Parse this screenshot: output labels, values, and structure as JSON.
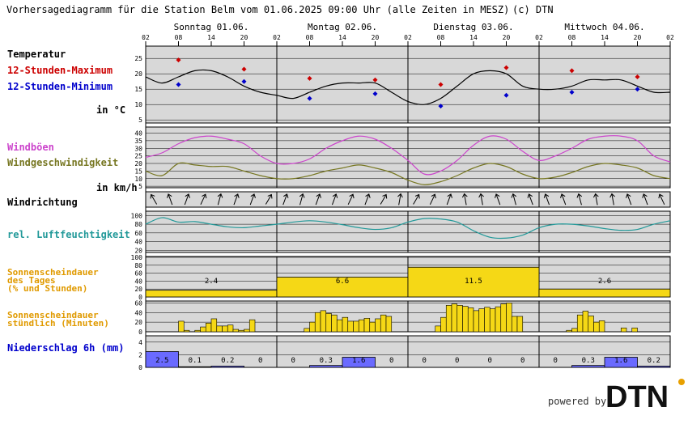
{
  "header": {
    "title": "Vorhersagediagramm für die Station Belm vom 01.06.2025 09:00 Uhr (alle Zeiten in MESZ)",
    "copyright": "(c) DTN"
  },
  "days": [
    "Sonntag 01.06.",
    "Montag 02.06.",
    "Dienstag 03.06.",
    "Mittwoch 04.06."
  ],
  "hour_labels": [
    "02",
    "08",
    "14",
    "20",
    "02",
    "08",
    "14",
    "20",
    "02",
    "08",
    "14",
    "20",
    "02",
    "08",
    "14",
    "20",
    "02"
  ],
  "panels": {
    "temperature": {
      "title": "Temperatur",
      "max_label": "12-Stunden-Maximum",
      "min_label": "12-Stunden-Minimum",
      "unit": "in °C",
      "ticks": [
        "25",
        "20",
        "15",
        "10",
        "5"
      ]
    },
    "wind": {
      "gust_label": "Windböen",
      "speed_label": "Windgeschwindigkeit",
      "unit": "in km/h",
      "ticks": [
        "40",
        "35",
        "30",
        "25",
        "20",
        "15",
        "10",
        "5"
      ]
    },
    "wind_direction": {
      "title": "Windrichtung"
    },
    "humidity": {
      "title": "rel. Luftfeuchtigkeit",
      "ticks": [
        "100",
        "80",
        "60",
        "40",
        "20"
      ]
    },
    "sun_daily": {
      "title_line1": "Sonnenscheindauer",
      "title_line2": "des Tages",
      "title_line3": "(% und Stunden)",
      "ticks": [
        "100",
        "80",
        "60",
        "40",
        "20",
        "0"
      ]
    },
    "sun_hourly": {
      "title_line1": "Sonnenscheindauer",
      "title_line2": "stündlich (Minuten)",
      "ticks": [
        "60",
        "40",
        "20",
        "0"
      ]
    },
    "precip": {
      "title": "Niederschlag 6h (mm)",
      "ticks": [
        "4",
        "2",
        "0"
      ]
    }
  },
  "branding": {
    "powered_by": "powered by",
    "logo_text": "DTN"
  },
  "colors": {
    "panel_bg": "#d8d8d8",
    "max": "#cc0000",
    "min": "#0000cc",
    "gust": "#cc44cc",
    "speed": "#777722",
    "humidity": "#229999",
    "sun_label": "#e09a00",
    "sun_fill": "#f5d816",
    "precip_label": "#0000cc",
    "precip_fill": "#6a6aff"
  },
  "chart_data": [
    {
      "type": "line",
      "name": "temperature",
      "x_hours": [
        0,
        3,
        6,
        9,
        12,
        15,
        18,
        21,
        24,
        27,
        30,
        33,
        36,
        39,
        42,
        45,
        48,
        51,
        54,
        57,
        60,
        63,
        66,
        69,
        72,
        75,
        78,
        81,
        84,
        87,
        90,
        93,
        96
      ],
      "y": [
        19,
        17,
        19,
        21,
        21,
        19,
        16,
        14,
        13,
        12,
        14,
        16,
        17,
        17,
        17,
        14,
        11,
        10,
        12,
        16,
        20,
        21,
        20,
        16,
        15,
        15,
        16,
        18,
        18,
        18,
        16,
        14,
        14
      ],
      "max_points": [
        {
          "h": 6,
          "v": 24.5
        },
        {
          "h": 18,
          "v": 21.5
        },
        {
          "h": 30,
          "v": 18.5
        },
        {
          "h": 42,
          "v": 18
        },
        {
          "h": 54,
          "v": 16.5
        },
        {
          "h": 66,
          "v": 22
        },
        {
          "h": 78,
          "v": 21
        },
        {
          "h": 90,
          "v": 19
        }
      ],
      "min_points": [
        {
          "h": 6,
          "v": 16.5
        },
        {
          "h": 18,
          "v": 17.5
        },
        {
          "h": 30,
          "v": 12
        },
        {
          "h": 42,
          "v": 13.5
        },
        {
          "h": 54,
          "v": 9.5
        },
        {
          "h": 66,
          "v": 13
        },
        {
          "h": 78,
          "v": 14
        },
        {
          "h": 90,
          "v": 15
        }
      ],
      "ylim": [
        4,
        29
      ]
    },
    {
      "type": "line",
      "name": "wind",
      "x_hours": [
        0,
        3,
        6,
        9,
        12,
        15,
        18,
        21,
        24,
        27,
        30,
        33,
        36,
        39,
        42,
        45,
        48,
        51,
        54,
        57,
        60,
        63,
        66,
        69,
        72,
        75,
        78,
        81,
        84,
        87,
        90,
        93,
        96
      ],
      "gusts": [
        24,
        27,
        33,
        37,
        38,
        36,
        33,
        25,
        20,
        20,
        23,
        30,
        35,
        38,
        36,
        30,
        22,
        13,
        15,
        22,
        32,
        38,
        36,
        28,
        22,
        25,
        30,
        36,
        38,
        38,
        35,
        25,
        21
      ],
      "speed": [
        15,
        12,
        20,
        19,
        18,
        18,
        15,
        12,
        10,
        10,
        12,
        15,
        17,
        19,
        17,
        14,
        9,
        6,
        8,
        12,
        17,
        20,
        18,
        13,
        10,
        11,
        14,
        18,
        20,
        19,
        17,
        12,
        10
      ],
      "ylim": [
        4,
        44
      ]
    },
    {
      "type": "line",
      "name": "humidity",
      "x_hours": [
        0,
        3,
        6,
        9,
        12,
        15,
        18,
        21,
        24,
        27,
        30,
        33,
        36,
        39,
        42,
        45,
        48,
        51,
        54,
        57,
        60,
        63,
        66,
        69,
        72,
        75,
        78,
        81,
        84,
        87,
        90,
        93,
        96
      ],
      "y": [
        80,
        95,
        85,
        86,
        80,
        74,
        72,
        76,
        80,
        85,
        88,
        85,
        79,
        72,
        68,
        72,
        85,
        93,
        92,
        85,
        65,
        50,
        48,
        55,
        72,
        80,
        80,
        76,
        70,
        66,
        68,
        80,
        88
      ],
      "ylim": [
        15,
        110
      ]
    },
    {
      "type": "bar",
      "name": "sun_daily",
      "days": [
        {
          "pct": 17,
          "hours": "2.4"
        },
        {
          "pct": 50,
          "hours": "6.6"
        },
        {
          "pct": 75,
          "hours": "11.5"
        },
        {
          "pct": 20,
          "hours": "2.6"
        }
      ],
      "ylim": [
        0,
        100
      ]
    },
    {
      "type": "bar",
      "name": "sun_hourly",
      "minutes": [
        0,
        0,
        0,
        0,
        0,
        0,
        22,
        3,
        0,
        3,
        10,
        18,
        27,
        12,
        12,
        14,
        5,
        3,
        5,
        25,
        0,
        0,
        0,
        0,
        0,
        0,
        0,
        0,
        0,
        7,
        20,
        40,
        44,
        38,
        35,
        25,
        30,
        22,
        22,
        25,
        28,
        20,
        27,
        35,
        32,
        0,
        0,
        0,
        0,
        0,
        0,
        0,
        0,
        12,
        30,
        55,
        58,
        55,
        53,
        50,
        44,
        48,
        51,
        48,
        52,
        58,
        60,
        32,
        32,
        0,
        0,
        0,
        0,
        0,
        0,
        0,
        0,
        3,
        7,
        35,
        43,
        33,
        20,
        23,
        0,
        0,
        0,
        8,
        0,
        8,
        0,
        0,
        0,
        0,
        0,
        0
      ],
      "ylim": [
        0,
        60
      ]
    },
    {
      "type": "bar",
      "name": "precip_6h",
      "values": [
        2.5,
        0.1,
        0.2,
        0,
        0,
        0.3,
        1.6,
        0,
        0,
        0,
        0,
        0,
        0,
        0.3,
        1.6,
        0.2
      ],
      "labels": [
        "2.5",
        "0.1",
        "0.2",
        "0",
        "0",
        "0.3",
        "1.6",
        "0",
        "0",
        "0",
        "0",
        "0",
        "0",
        "0.3",
        "1.6",
        "0.2"
      ],
      "ylim": [
        0,
        5
      ]
    }
  ]
}
